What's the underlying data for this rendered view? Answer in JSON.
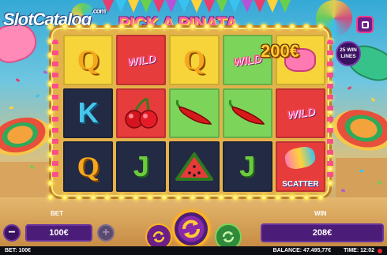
{
  "branding": {
    "logo_text": "SlotCatalog",
    "logo_sup": ".com",
    "game_title": "PICK A PINATA"
  },
  "header": {
    "menu_icon": "window-icon"
  },
  "win_lines": {
    "label": "25 WIN LINES"
  },
  "reels": {
    "rows": [
      [
        {
          "symbol": "Q",
          "bg": "#f6d43a"
        },
        {
          "symbol": "WILD",
          "bg": "#e63c3c"
        },
        {
          "symbol": "Q",
          "bg": "#f6d43a"
        },
        {
          "symbol": "WILD",
          "bg": "#7dd45a"
        },
        {
          "symbol": "",
          "bg": "#f6d43a"
        }
      ],
      [
        {
          "symbol": "K",
          "bg": "#232a44"
        },
        {
          "symbol": "cherries",
          "bg": "#e63c3c"
        },
        {
          "symbol": "pepper",
          "bg": "#7dd45a"
        },
        {
          "symbol": "pepper",
          "bg": "#7dd45a"
        },
        {
          "symbol": "WILD",
          "bg": "#e63c3c"
        }
      ],
      [
        {
          "symbol": "Q",
          "bg": "#232a44"
        },
        {
          "symbol": "J",
          "bg": "#232a44"
        },
        {
          "symbol": "watermelon",
          "bg": "#232a44"
        },
        {
          "symbol": "J",
          "bg": "#232a44"
        },
        {
          "symbol": "SCATTER",
          "bg": "#e63c3c"
        }
      ]
    ]
  },
  "win_amount": "200€",
  "bet": {
    "label": "BET",
    "value": "100€",
    "minus": "−",
    "plus": "+"
  },
  "win": {
    "label": "WIN",
    "value": "208€"
  },
  "status": {
    "bet": "BET: 100€",
    "balance": "BALANCE: 47.495,77€",
    "time": "TIME: 12:02"
  },
  "colors": {
    "accent": "#ff3c8c",
    "panel": "#4c1d78",
    "spin": "#ffb321"
  }
}
